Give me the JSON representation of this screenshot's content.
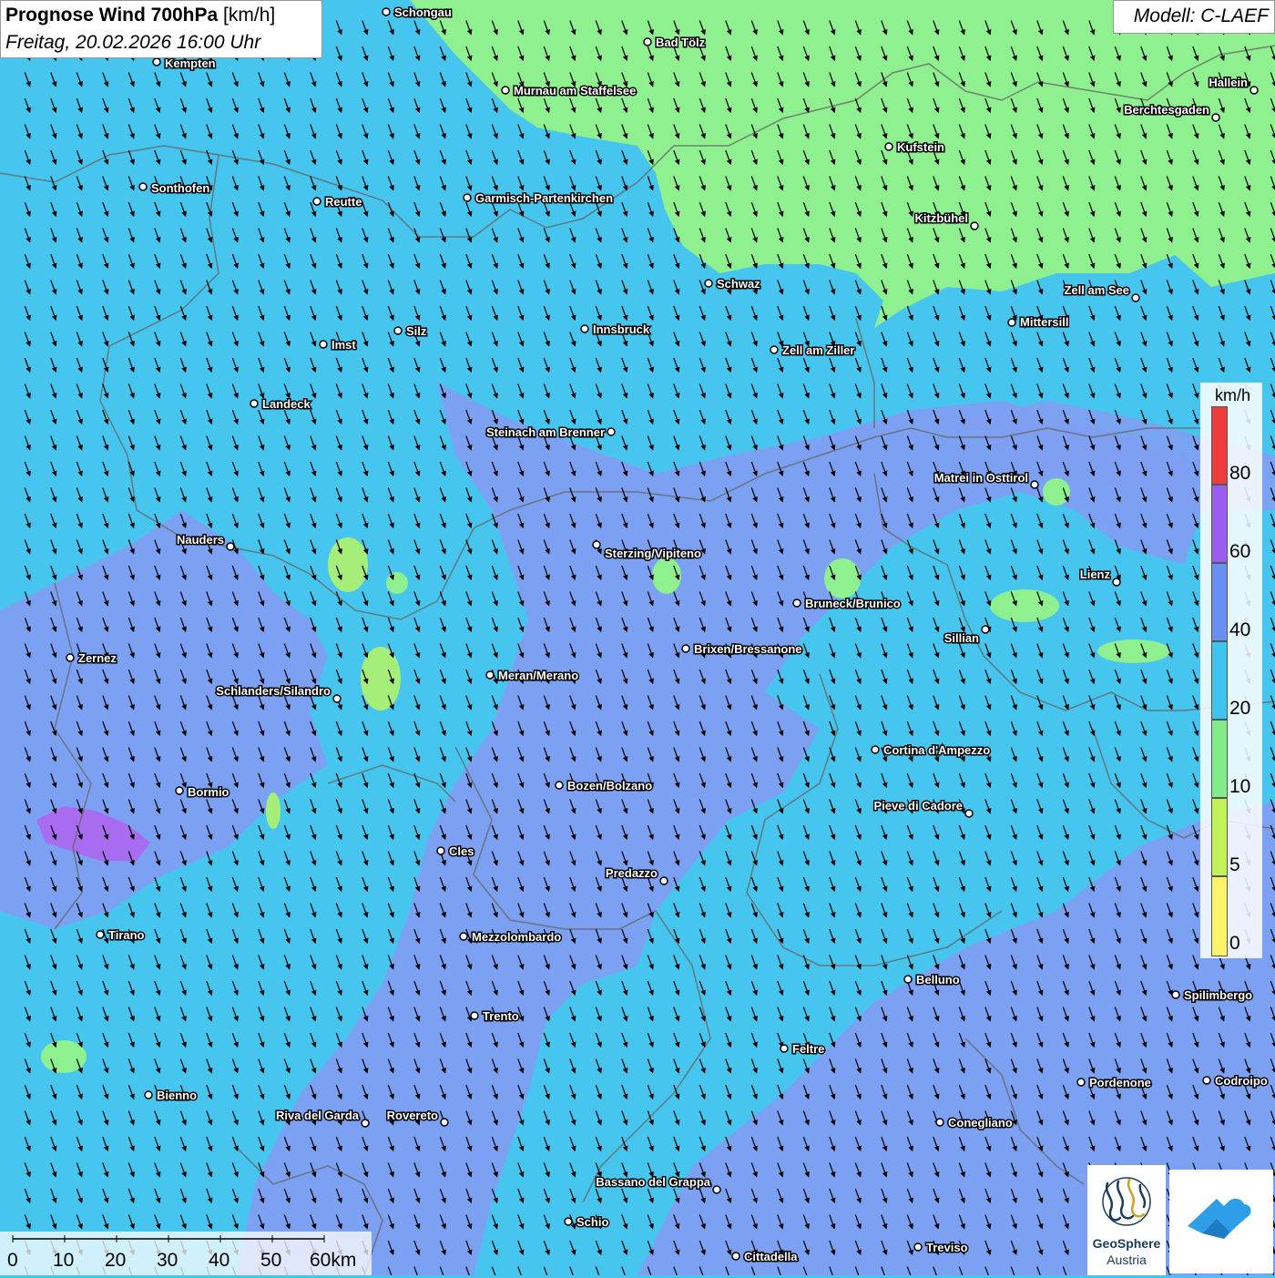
{
  "title": {
    "main": "Prognose Wind 700hPa",
    "unit": "[km/h]",
    "datetime": "Freitag, 20.02.2026 16:00 Uhr"
  },
  "model": "Modell: C-LAEF",
  "legend": {
    "unit": "km/h",
    "ticks": [
      "80",
      "60",
      "40",
      "20",
      "10",
      "5",
      "0"
    ],
    "bands": [
      {
        "from": 80,
        "to": 100,
        "color": "#ee3b3b"
      },
      {
        "from": 60,
        "to": 80,
        "color": "#9b5cf0"
      },
      {
        "from": 40,
        "to": 60,
        "color": "#6a8ff2"
      },
      {
        "from": 20,
        "to": 40,
        "color": "#3fc4f0"
      },
      {
        "from": 10,
        "to": 20,
        "color": "#82ec88"
      },
      {
        "from": 5,
        "to": 10,
        "color": "#c2f25a"
      },
      {
        "from": 0,
        "to": 5,
        "color": "#fbf46a"
      }
    ]
  },
  "scale": {
    "labels": [
      "0",
      "10",
      "20",
      "30",
      "40",
      "50",
      "60km"
    ]
  },
  "logos": {
    "geosphere_line1": "GeoSphere",
    "geosphere_line2": "Austria"
  },
  "wind_direction_deg": 340,
  "cities": [
    "Schongau",
    "Bad Tölz",
    "Kempten",
    "Murnau am Staffelsee",
    "Hallein",
    "Berchtesgaden",
    "Kufstein",
    "Sonthofen",
    "Reutte",
    "Garmisch-Partenkirchen",
    "Kitzbühel",
    "Schwaz",
    "Zell am See",
    "Mittersill",
    "Innsbruck",
    "Silz",
    "Imst",
    "Zell am Ziller",
    "Landeck",
    "Steinach am Brenner",
    "Matrei in Osttirol",
    "Nauders",
    "Sterzing/Vipiteno",
    "Lienz",
    "Bruneck/Brunico",
    "Sillian",
    "Brixen/Bressanone",
    "Zernez",
    "Meran/Merano",
    "Schlanders/Silandro",
    "Cortina d'Ampezzo",
    "Bozen/Bolzano",
    "Bormio",
    "Pieve di Cadore",
    "Cles",
    "Predazzo",
    "Tirano",
    "Mezzolombardo",
    "Belluno",
    "Spilimbergo",
    "Trento",
    "Feltre",
    "Pordenone",
    "Codroipo",
    "Bienno",
    "Riva del Garda",
    "Rovereto",
    "Conegliano",
    "Bassano del Grappa",
    "Schio",
    "Treviso",
    "Cittadella"
  ]
}
